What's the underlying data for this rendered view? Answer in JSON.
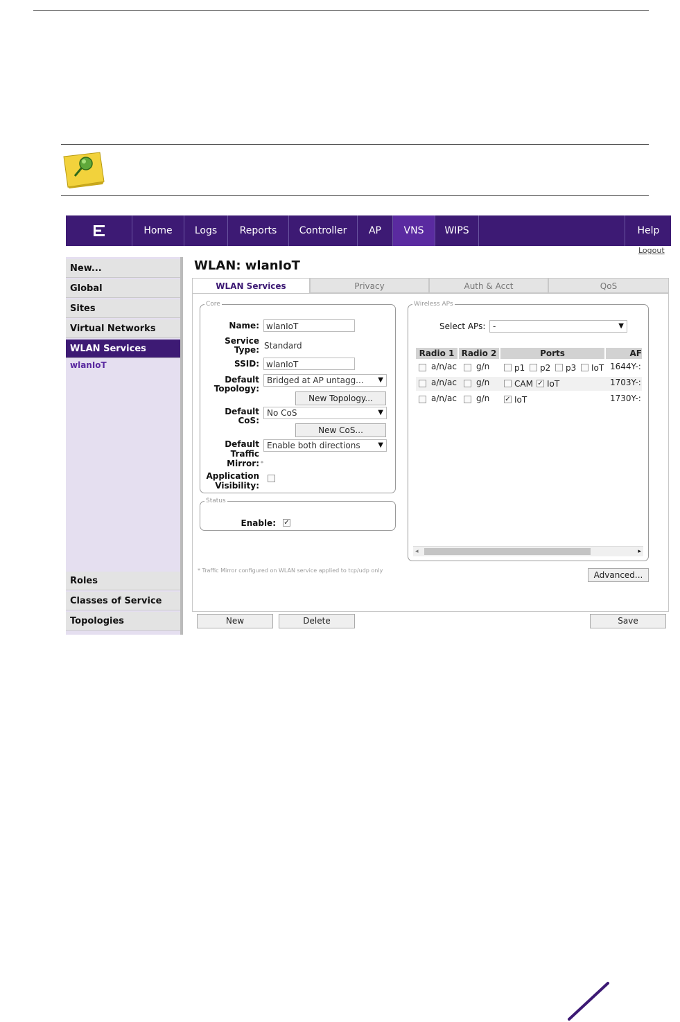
{
  "nav": {
    "items": [
      {
        "label": "Home"
      },
      {
        "label": "Logs"
      },
      {
        "label": "Reports"
      },
      {
        "label": "Controller"
      },
      {
        "label": "AP"
      },
      {
        "label": "VNS"
      },
      {
        "label": "WIPS"
      },
      {
        "label": "Help"
      }
    ],
    "active": "VNS",
    "logout": "Logout"
  },
  "sidebar": {
    "top_items": [
      {
        "label": "New..."
      },
      {
        "label": "Global"
      },
      {
        "label": "Sites"
      },
      {
        "label": "Virtual Networks"
      },
      {
        "label": "WLAN Services"
      }
    ],
    "sub_item": "wlanIoT",
    "bottom_items": [
      {
        "label": "Roles"
      },
      {
        "label": "Classes of Service"
      },
      {
        "label": "Topologies"
      }
    ]
  },
  "main": {
    "title": "WLAN: wlanIoT",
    "tabs": [
      {
        "label": "WLAN Services"
      },
      {
        "label": "Privacy"
      },
      {
        "label": "Auth & Acct"
      },
      {
        "label": "QoS"
      }
    ]
  },
  "core": {
    "legend": "Core",
    "name_label": "Name:",
    "name_value": "wlanIoT",
    "service_type_label_1": "Service",
    "service_type_label_2": "Type:",
    "service_type_value": "Standard",
    "ssid_label": "SSID:",
    "ssid_value": "wlanIoT",
    "topology_label_1": "Default",
    "topology_label_2": "Topology:",
    "topology_value": "Bridged at AP untagg...",
    "new_topology_button": "New Topology...",
    "cos_label_1": "Default",
    "cos_label_2": "CoS:",
    "cos_value": "No CoS",
    "new_cos_button": "New CoS...",
    "mirror_label_1": "Default",
    "mirror_label_2": "Traffic",
    "mirror_label_3": "Mirror:",
    "mirror_asterisk": "*",
    "mirror_value": "Enable both directions",
    "app_vis_label_1": "Application",
    "app_vis_label_2": "Visibility:"
  },
  "status": {
    "legend": "Status",
    "enable_label": "Enable:"
  },
  "wireless_aps": {
    "legend": "Wireless APs",
    "select_label": "Select APs:",
    "select_value": "-",
    "headers": [
      "Radio 1",
      "Radio 2",
      "Ports",
      "AF"
    ],
    "rows": [
      {
        "radio1": "a/n/ac",
        "radio2": "g/n",
        "ports": [
          {
            "label": "p1",
            "checked": false
          },
          {
            "label": "p2",
            "checked": false
          },
          {
            "label": "p3",
            "checked": false
          },
          {
            "label": "IoT",
            "checked": false
          }
        ],
        "ap": "1644Y-:"
      },
      {
        "radio1": "a/n/ac",
        "radio2": "g/n",
        "ports": [
          {
            "label": "CAM",
            "checked": false
          },
          {
            "label": "IoT",
            "checked": true
          }
        ],
        "ap": "1703Y-:"
      },
      {
        "radio1": "a/n/ac",
        "radio2": "g/n",
        "ports": [
          {
            "label": "IoT",
            "checked": true
          }
        ],
        "ap": "1730Y-:"
      }
    ]
  },
  "footnote": "* Traffic Mirror configured on WLAN service applied to tcp/udp only",
  "buttons": {
    "advanced": "Advanced...",
    "new": "New",
    "delete": "Delete",
    "save": "Save"
  },
  "colors": {
    "brand": "#3d1a74",
    "nav_active": "#5a2aa0",
    "note_yellow": "#f2d23c"
  }
}
